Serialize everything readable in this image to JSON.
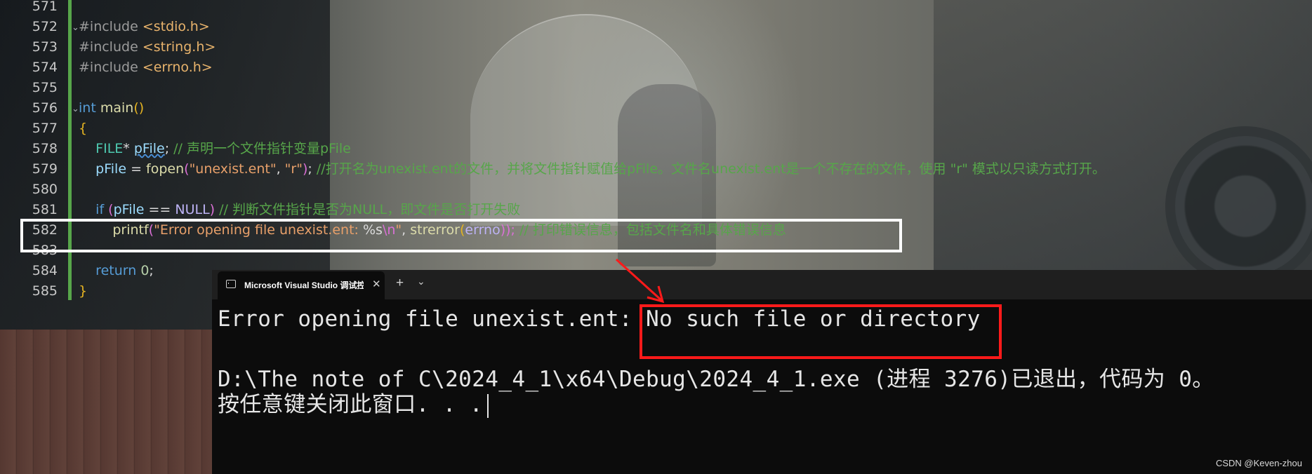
{
  "editor": {
    "lines": [
      {
        "num": "571"
      },
      {
        "num": "572",
        "fold": "⌄"
      },
      {
        "num": "573"
      },
      {
        "num": "574"
      },
      {
        "num": "575"
      },
      {
        "num": "576",
        "fold": "⌄"
      },
      {
        "num": "577"
      },
      {
        "num": "578"
      },
      {
        "num": "579"
      },
      {
        "num": "580"
      },
      {
        "num": "581"
      },
      {
        "num": "582"
      },
      {
        "num": "583"
      },
      {
        "num": "584"
      },
      {
        "num": "585"
      }
    ],
    "code": {
      "l572_pp": "#include ",
      "l572_hdr": "<stdio.h>",
      "l573_pp": "#include ",
      "l573_hdr": "<string.h>",
      "l574_pp": "#include ",
      "l574_hdr": "<errno.h>",
      "l576_kw": "int",
      "l576_fn": "main",
      "l576_paren": "()",
      "l577_brace": "{",
      "l578_type": "FILE",
      "l578_star": "* ",
      "l578_var": "pFile",
      "l578_semi": ";",
      "l578_comment": " // 声明一个文件指针变量pFile",
      "l579_var": "pFile",
      "l579_eq": " = ",
      "l579_fn": "fopen",
      "l579_p1": "(",
      "l579_str1": "\"unexist.ent\"",
      "l579_comma": ", ",
      "l579_str2": "\"r\"",
      "l579_p2": ")",
      "l579_semi": ";",
      "l579_comment": " //打开名为unexist.ent的文件，并将文件指针赋值给pFile。文件名unexist.ent是一个不存在的文件，使用 \"r\" 模式以只读方式打开。",
      "l581_kw": "if",
      "l581_p1": " (",
      "l581_var": "pFile",
      "l581_eq": " == ",
      "l581_mac": "NULL",
      "l581_p2": ")",
      "l581_comment": " // 判断文件指针是否为NULL，即文件是否打开失败",
      "l582_fn": "printf",
      "l582_p1": "(",
      "l582_str": "\"Error opening file unexist.ent: ",
      "l582_fmt": "%s",
      "l582_esc": "\\n",
      "l582_strend": "\"",
      "l582_comma": ", ",
      "l582_fn2": "strerror",
      "l582_p3": "(",
      "l582_var": "errno",
      "l582_p4": "));",
      "l582_comment": " // 打印错误信息，包括文件名和具体错误信息",
      "l584_kw": "return",
      "l584_num": " 0",
      "l584_semi": ";",
      "l585_brace": "}"
    }
  },
  "terminal": {
    "tab_title": "Microsoft Visual Studio 调试控制台",
    "tab_close": "✕",
    "new_tab": "+",
    "dropdown": "⌄",
    "output_prefix": "Error opening file unexist.ent: ",
    "output_error": "No such file or directory",
    "exit_line": "D:\\The note of C\\2024_4_1\\x64\\Debug\\2024_4_1.exe (进程 3276)已退出，代码为 0。",
    "prompt_line": "按任意键关闭此窗口. . ."
  },
  "watermark": "CSDN @Keven-zhou",
  "colors": {
    "highlight_box": "#ffffff",
    "error_box": "#ff1a1a",
    "arrow": "#ff1a1a"
  }
}
